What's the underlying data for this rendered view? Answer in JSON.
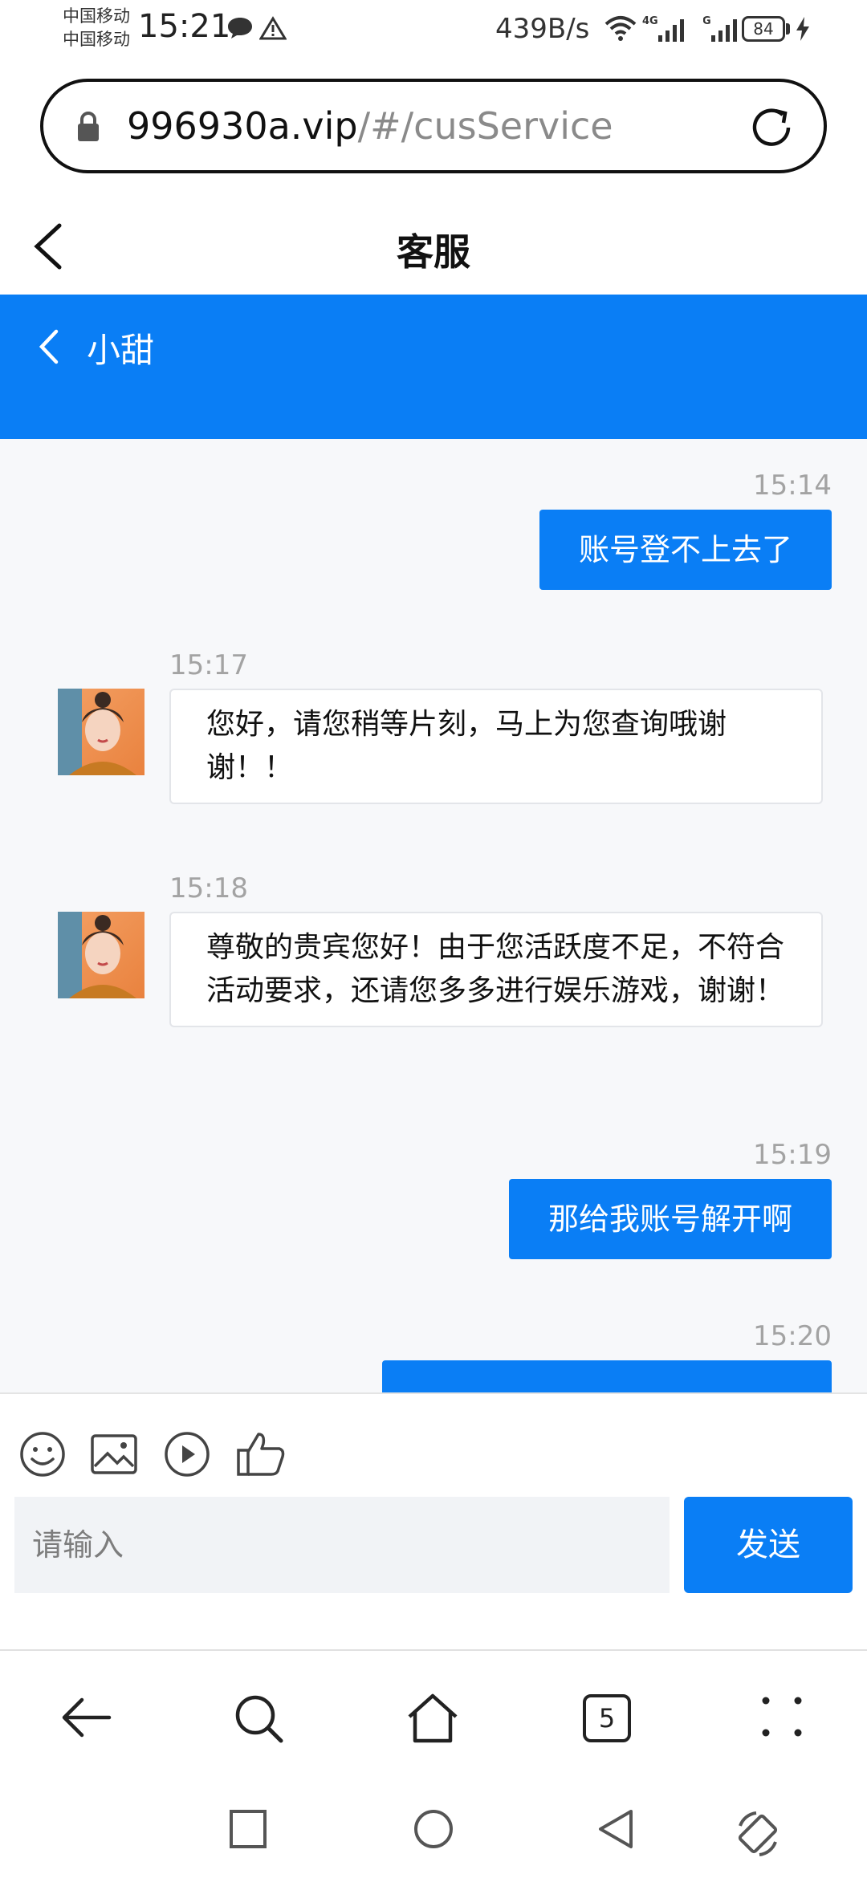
{
  "status_bar": {
    "carrier_1": "中国移动",
    "carrier_2": "中国移动",
    "time": "15:21",
    "net_speed": "439B/s",
    "signal_label_1": "4G",
    "signal_label_2": "4G",
    "battery": "84"
  },
  "browser": {
    "url_host": "996930a.vip",
    "url_path": "/#/cusService",
    "tab_count": "5"
  },
  "page": {
    "title": "客服"
  },
  "chat": {
    "contact_name": "小甜",
    "messages": [
      {
        "time": "15:14",
        "direction": "outgoing",
        "text": "账号登不上去了"
      },
      {
        "time": "15:17",
        "direction": "incoming",
        "text": "您好，请您稍等片刻，马上为您查询哦谢谢！！"
      },
      {
        "time": "15:18",
        "direction": "incoming",
        "text": "尊敬的贵宾您好！由于您活跃度不足，不符合活动要求，还请您多多进行娱乐游戏，谢谢！"
      },
      {
        "time": "15:19",
        "direction": "outgoing",
        "text": "那给我账号解开啊"
      },
      {
        "time": "15:20",
        "direction": "outgoing",
        "text": ""
      }
    ]
  },
  "composer": {
    "placeholder": "请输入",
    "send_label": "发送"
  },
  "colors": {
    "accent": "#0a7ef5",
    "message_area_bg": "#f7f8fa",
    "timestamp": "#a3a3a3"
  },
  "icons": {
    "status": [
      "chat-bubble-icon",
      "warning-icon",
      "wifi-icon",
      "signal-icon",
      "battery-icon",
      "charging-bolt-icon"
    ],
    "url_bar": [
      "lock-icon",
      "reload-icon"
    ],
    "composer_tools": [
      "emoji-icon",
      "image-icon",
      "video-play-icon",
      "thumbs-up-icon"
    ],
    "browser_toolbar": [
      "back-arrow-icon",
      "search-icon",
      "home-icon",
      "tabs-icon",
      "more-menu-icon"
    ],
    "system_nav": [
      "recents-square-icon",
      "home-circle-icon",
      "back-triangle-icon",
      "rotate-icon"
    ]
  }
}
